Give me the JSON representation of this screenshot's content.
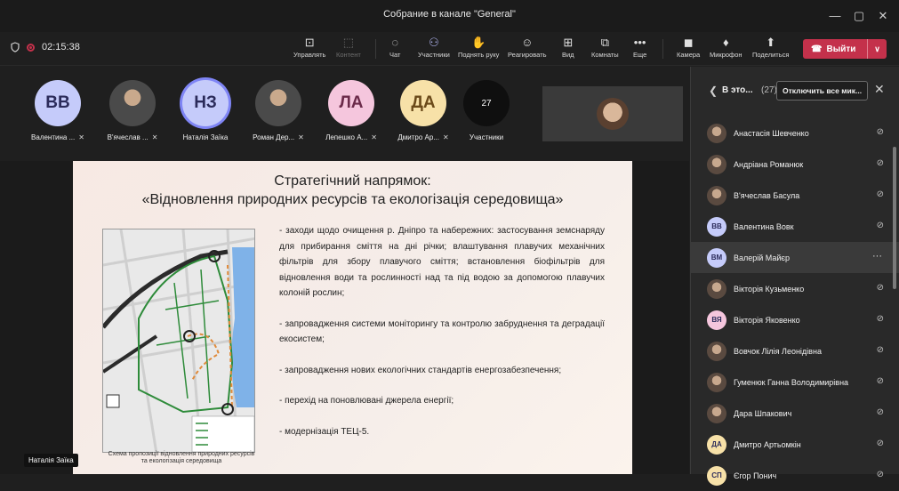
{
  "window": {
    "title": "Собрание в канале \"General\"",
    "controls": [
      "—",
      "▢",
      "✕"
    ]
  },
  "toolbar": {
    "timer": "02:15:38",
    "tools": [
      {
        "name": "manage",
        "label": "Управлять",
        "icon": "▢⌕"
      },
      {
        "name": "content",
        "label": "Контент",
        "icon": "⬚"
      },
      {
        "name": "chat",
        "label": "Чат",
        "icon": "☺"
      },
      {
        "name": "participants",
        "label": "Участники",
        "icon": "⚇"
      },
      {
        "name": "raise-hand",
        "label": "Поднять руку",
        "icon": "✋"
      },
      {
        "name": "react",
        "label": "Реагировать",
        "icon": "☺"
      },
      {
        "name": "view",
        "label": "Вид",
        "icon": "⊞"
      },
      {
        "name": "rooms",
        "label": "Комнаты",
        "icon": "⧉"
      },
      {
        "name": "more",
        "label": "Еще",
        "icon": "•••"
      },
      {
        "name": "camera",
        "label": "Камера",
        "icon": "◼"
      },
      {
        "name": "mic",
        "label": "Микрофон",
        "icon": "🎙"
      },
      {
        "name": "share",
        "label": "Поделиться",
        "icon": "⬆"
      }
    ],
    "leave_label": "Выйти"
  },
  "strip": {
    "people": [
      {
        "initials": "ВВ",
        "name": "Валентина ...",
        "color": "#c5cbfa",
        "photo": false,
        "ring": false
      },
      {
        "initials": "",
        "name": "В'ячеслав ...",
        "color": "#4a4a4a",
        "photo": true,
        "ring": false
      },
      {
        "initials": "НЗ",
        "name": "Наталія Заїка",
        "color": "#c5cbfa",
        "photo": false,
        "ring": true
      },
      {
        "initials": "",
        "name": "Роман Дер...",
        "color": "#4a4a4a",
        "photo": true,
        "ring": false
      },
      {
        "initials": "ЛА",
        "name": "Лепешко А...",
        "color": "#f5c6dd",
        "photo": false,
        "ring": false
      },
      {
        "initials": "ДА",
        "name": "Дмитро Ар...",
        "color": "#f7e1a8",
        "photo": false,
        "ring": false
      }
    ],
    "count": "27",
    "count_label": "Участники"
  },
  "slide": {
    "title": "Стратегічний напрямок:",
    "subtitle": "«Відновлення природних ресурсів та екологізація середовища»",
    "bullets": [
      "- заходи щодо очищення р. Дніпро та набережних: застосування земснаряду для прибирання сміття на дні річки; влаштування плавучих механічних фільтрів для збору плавучого сміття; встановлення біофільтрів для відновлення води та рослинності над та під водою за допомогою плавучих колоній рослин;",
      "- запровадження системи моніторингу та контролю забруднення та деградації екосистем;",
      "- запровадження нових екологічних стандартів енергозабезпечення;",
      "- перехід на поновлювані джерела енергії;",
      "- модернізація ТЕЦ-5."
    ],
    "map_caption": "Схема пропозиції відновлення природних ресурсів та екологізація середовища",
    "speaker": "Наталія Заїка"
  },
  "panel": {
    "title": "В это...",
    "count": "(27)",
    "mute_all": "Отключить все мик...",
    "participants": [
      {
        "initials": "",
        "name": "Анастасія Шевченко",
        "color": "#5a4a40",
        "photo": true
      },
      {
        "initials": "",
        "name": "Андріана Романюк",
        "color": "#5a4a40",
        "photo": true
      },
      {
        "initials": "",
        "name": "В'ячеслав Басула",
        "color": "#5a4a40",
        "photo": true
      },
      {
        "initials": "ВВ",
        "name": "Валентина Вовк",
        "color": "#c5cbfa",
        "photo": false
      },
      {
        "initials": "ВМ",
        "name": "Валерій Майєр",
        "color": "#c5cbfa",
        "photo": false
      },
      {
        "initials": "",
        "name": "Вікторія Кузьменко",
        "color": "#5a4a40",
        "photo": true
      },
      {
        "initials": "ВЯ",
        "name": "Вікторія Яковенко",
        "color": "#f5c6dd",
        "photo": false
      },
      {
        "initials": "",
        "name": "Вовчок Лілія Леонідівна",
        "color": "#5a4a40",
        "photo": true
      },
      {
        "initials": "",
        "name": "Гуменюк Ганна Володимирівна",
        "color": "#5a4a40",
        "photo": true
      },
      {
        "initials": "",
        "name": "Дара Шпакович",
        "color": "#5a4a40",
        "photo": true
      },
      {
        "initials": "ДА",
        "name": "Дмитро Артьомкін",
        "color": "#f7e1a8",
        "photo": false
      },
      {
        "initials": "СП",
        "name": "Єгор Понич",
        "color": "#f7e1a8",
        "photo": false
      }
    ],
    "selected_index": 4
  },
  "colors": {
    "accent": "#7f85f5",
    "leave": "#c4314b"
  }
}
